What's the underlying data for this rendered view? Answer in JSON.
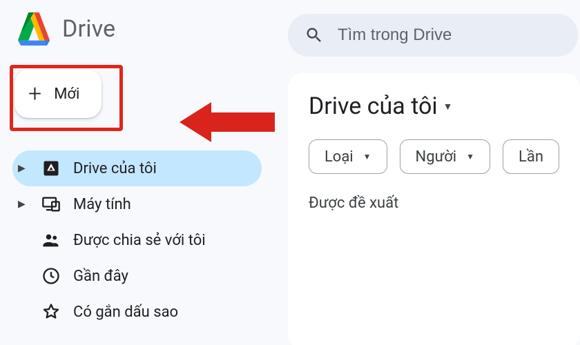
{
  "app_name": "Drive",
  "new_button_label": "Mới",
  "search_placeholder": "Tìm trong Drive",
  "nav": {
    "my_drive": "Drive của tôi",
    "computers": "Máy tính",
    "shared": "Được chia sẻ với tôi",
    "recent": "Gần đây",
    "starred": "Có gắn dấu sao"
  },
  "main": {
    "heading": "Drive của tôi",
    "suggested_label": "Được đề xuất"
  },
  "chips": {
    "type": "Loại",
    "people": "Người",
    "modified": "Lần"
  }
}
